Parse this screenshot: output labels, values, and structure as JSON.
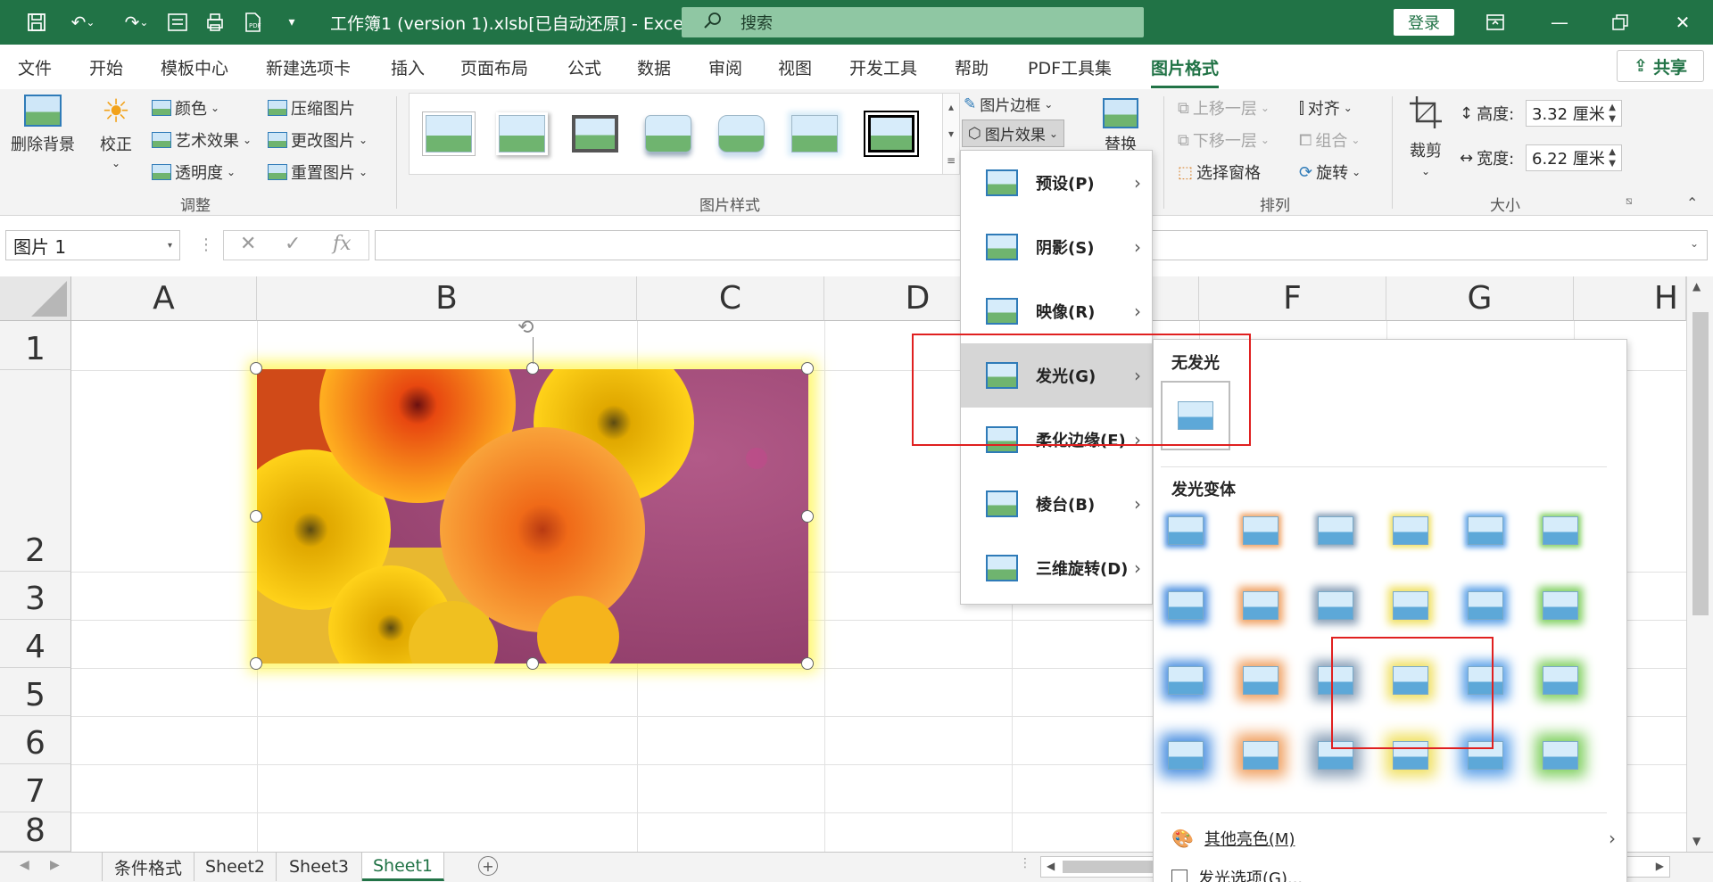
{
  "window": {
    "title": "工作簿1 (version 1).xlsb[已自动还原]  -  Excel",
    "search_placeholder": "搜索",
    "login_label": "登录"
  },
  "menu": {
    "tabs": [
      "文件",
      "开始",
      "模板中心",
      "新建选项卡",
      "插入",
      "页面布局",
      "公式",
      "数据",
      "审阅",
      "视图",
      "开发工具",
      "帮助",
      "PDF工具集",
      "图片格式"
    ],
    "active_tab": "图片格式",
    "share_label": "共享"
  },
  "ribbon": {
    "remove_bg": "删除背景",
    "correct": "校正",
    "color": "颜色",
    "artistic": "艺术效果",
    "transparency": "透明度",
    "compress": "压缩图片",
    "change": "更改图片",
    "reset": "重置图片",
    "group_adjust": "调整",
    "group_styles": "图片样式",
    "border": "图片边框",
    "effects": "图片效果",
    "replace": "替换",
    "bring_forward": "上移一层",
    "send_backward": "下移一层",
    "selection_pane": "选择窗格",
    "align": "对齐",
    "group": "组合",
    "rotate": "旋转",
    "group_arrange": "排列",
    "crop": "裁剪",
    "height_label": "高度:",
    "height_value": "3.32 厘米",
    "width_label": "宽度:",
    "width_value": "6.22 厘米",
    "group_size": "大小"
  },
  "formula_bar": {
    "name_box": "图片 1",
    "fx": "fx"
  },
  "sheet": {
    "columns": [
      "A",
      "B",
      "C",
      "D",
      "E",
      "F",
      "G",
      "H"
    ],
    "rows": [
      "1",
      "2",
      "3",
      "4",
      "5",
      "6",
      "7",
      "8"
    ],
    "tabs": [
      "条件格式",
      "Sheet2",
      "Sheet3",
      "Sheet1"
    ],
    "active_tab": "Sheet1"
  },
  "effects_menu": {
    "items": [
      "预设(P)",
      "阴影(S)",
      "映像(R)",
      "发光(G)",
      "柔化边缘(E)",
      "棱台(B)",
      "三维旋转(D)"
    ],
    "highlighted": "发光(G)"
  },
  "glow_menu": {
    "no_glow": "无发光",
    "variants_title": "发光变体",
    "glow_colors": [
      "#4a8fe0",
      "#f0a060",
      "#8aa0b8",
      "#f0e060",
      "#5aa0e8",
      "#80d060"
    ],
    "other_colors": "其他亮色(M)",
    "glow_options": "发光选项(G)..."
  },
  "colors": {
    "excel_green": "#217346",
    "highlight_red": "#e02020",
    "picture_glow": "#fff550"
  }
}
